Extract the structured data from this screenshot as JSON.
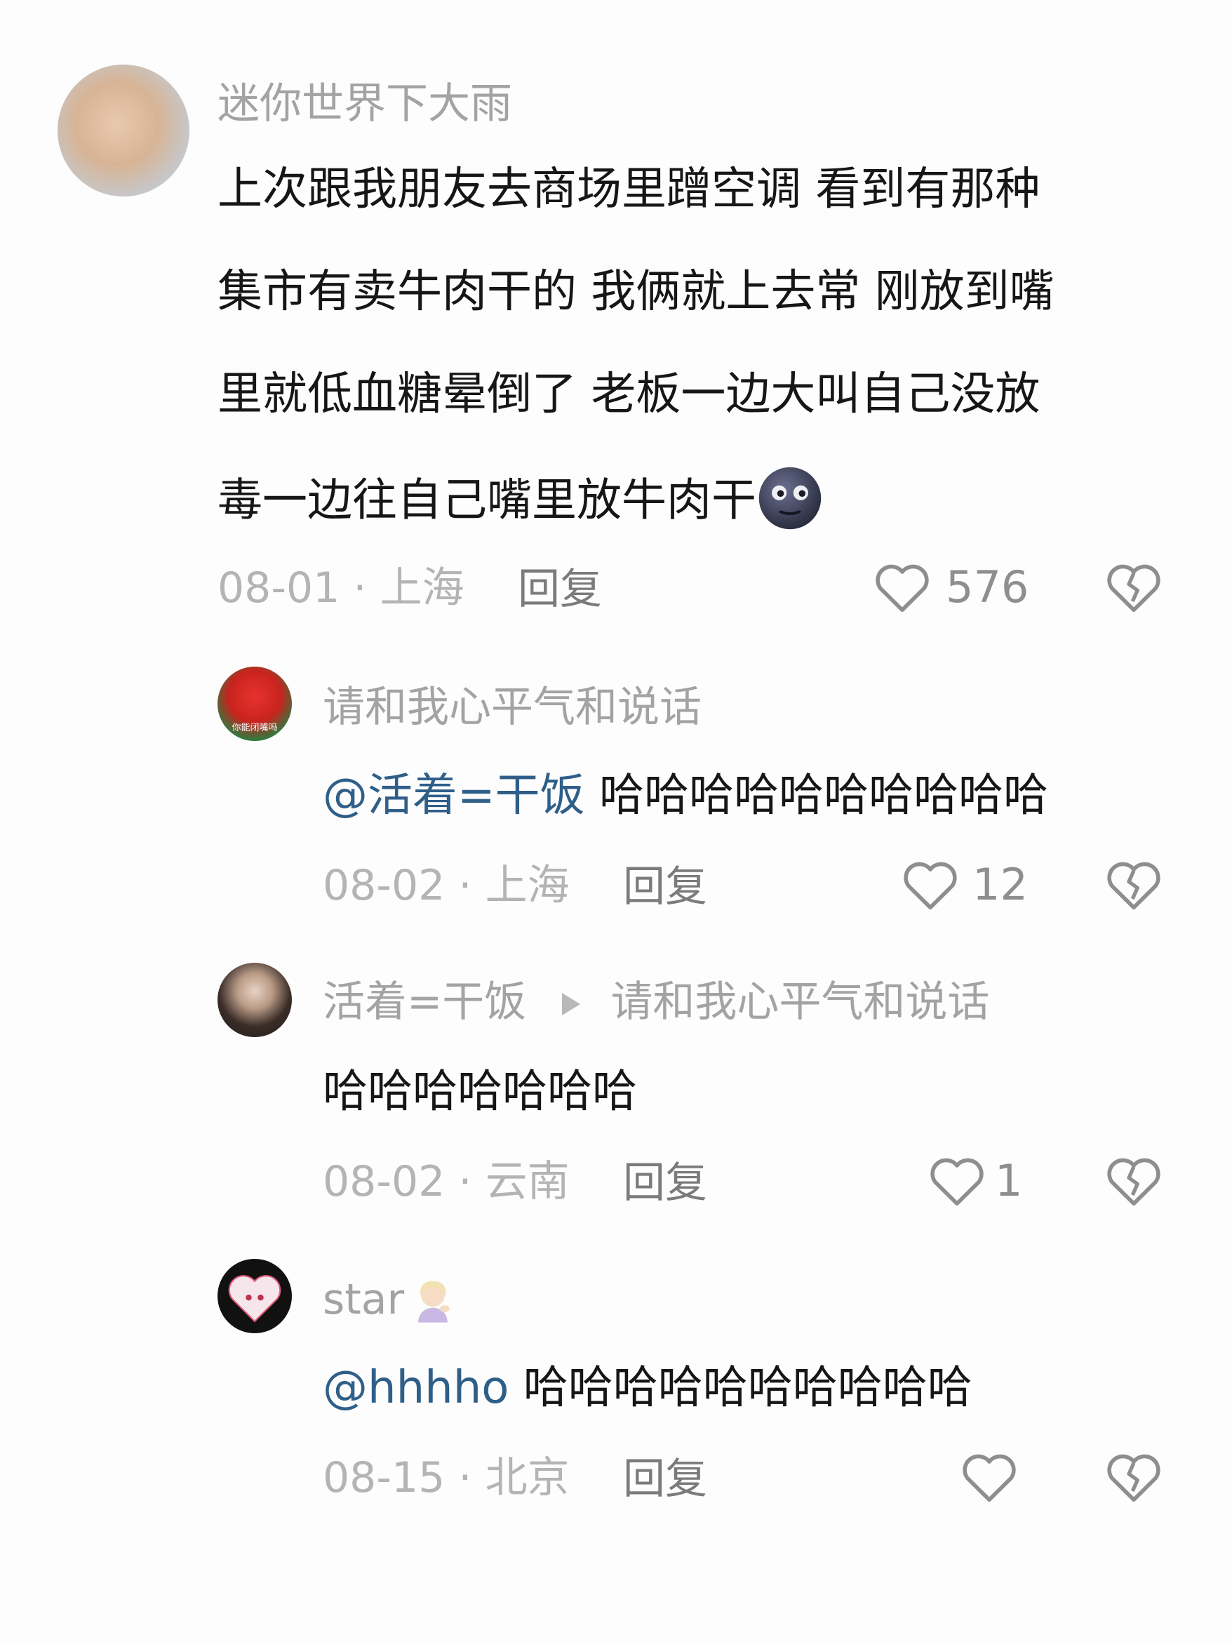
{
  "comments": [
    {
      "username": "迷你世界下大雨",
      "lines": [
        "上次跟我朋友去商场里蹭空调 看到有那种",
        "集市有卖牛肉干的 我俩就上去常 刚放到嘴",
        "里就低血糖晕倒了 老板一边大叫自己没放",
        "毒一边往自己嘴里放牛肉干"
      ],
      "emoji": "new-moon-face",
      "date": "08-01",
      "location": "上海",
      "reply_label": "回复",
      "likes": "576"
    },
    {
      "username": "请和我心平气和说话",
      "avatar_text": "你能闭嘴吗",
      "mention": "@活着=干饭",
      "text": "哈哈哈哈哈哈哈哈哈哈",
      "date": "08-02",
      "location": "上海",
      "reply_label": "回复",
      "likes": "12"
    },
    {
      "username": "活着=干饭",
      "reply_to": "请和我心平气和说话",
      "text": "哈哈哈哈哈哈哈",
      "date": "08-02",
      "location": "云南",
      "reply_label": "回复",
      "likes": "1"
    },
    {
      "username": "star",
      "username_emoji": "person-tipping-hand",
      "mention": "@hhhho",
      "text": "哈哈哈哈哈哈哈哈哈哈",
      "date": "08-15",
      "location": "北京",
      "reply_label": "回复",
      "likes": ""
    }
  ],
  "icons": {
    "like": "heart-outline-icon",
    "dislike": "broken-heart-icon",
    "reply_arrow": "play-triangle-icon"
  },
  "colors": {
    "mention": "#2f5f89",
    "username": "#a3a3a3",
    "meta": "#b4b4b4"
  },
  "separator": " · "
}
